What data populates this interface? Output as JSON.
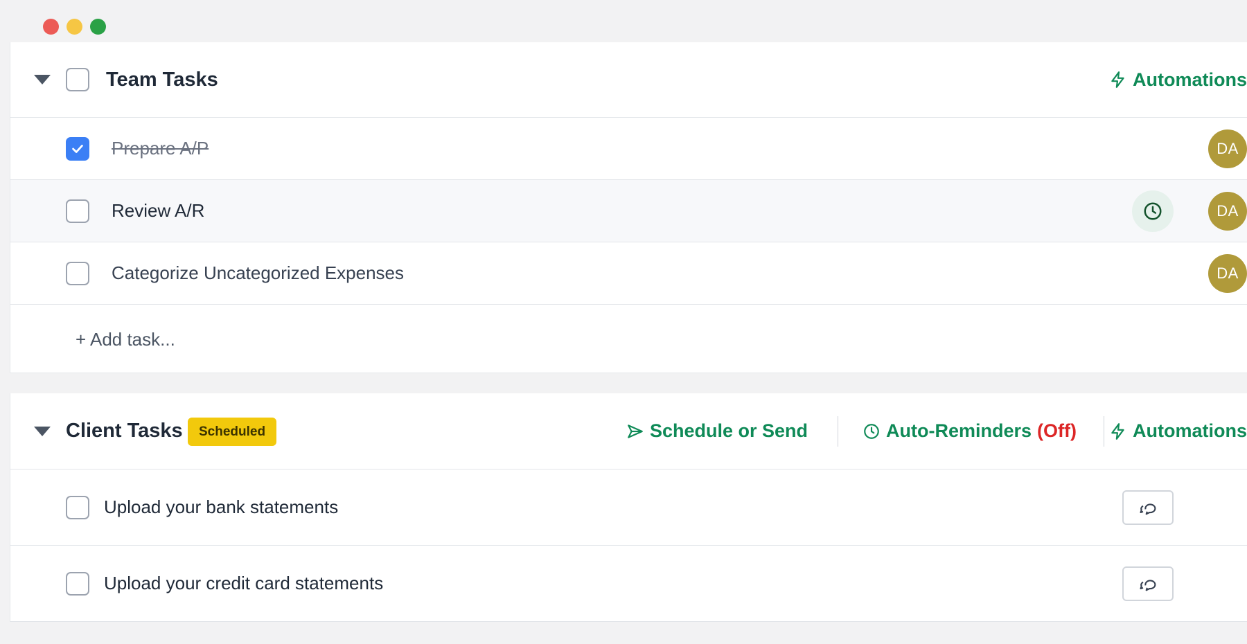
{
  "window": {
    "controls": [
      "close",
      "minimize",
      "maximize"
    ]
  },
  "team_tasks": {
    "title": "Team Tasks",
    "automations_label": "Automations",
    "tasks": [
      {
        "label": "Prepare A/P",
        "completed": true,
        "assignee": "DA"
      },
      {
        "label": "Review A/R",
        "completed": false,
        "assignee": "DA",
        "has_reminder": true
      },
      {
        "label": "Categorize Uncategorized Expenses",
        "completed": false,
        "assignee": "DA"
      }
    ],
    "add_task_label": "+ Add task..."
  },
  "client_tasks": {
    "title": "Client Tasks",
    "badge": "Scheduled",
    "schedule_label": "Schedule or Send",
    "reminders_label": "Auto-Reminders",
    "reminders_state": "(Off)",
    "automations_label": "Automations",
    "tasks": [
      {
        "label": "Upload your bank statements",
        "completed": false
      },
      {
        "label": "Upload your credit card statements",
        "completed": false
      }
    ]
  },
  "colors": {
    "accent_green": "#0f8a57",
    "off_red": "#dc2626",
    "badge_yellow": "#f2c90c",
    "avatar": "#b09a3a",
    "checkbox_checked": "#3b7ff5"
  },
  "icons": {
    "caret": "caret-down-icon",
    "bolt": "lightning-bolt-icon",
    "send": "send-icon",
    "clock": "clock-icon",
    "chat": "chat-bubbles-icon",
    "check": "check-icon"
  }
}
